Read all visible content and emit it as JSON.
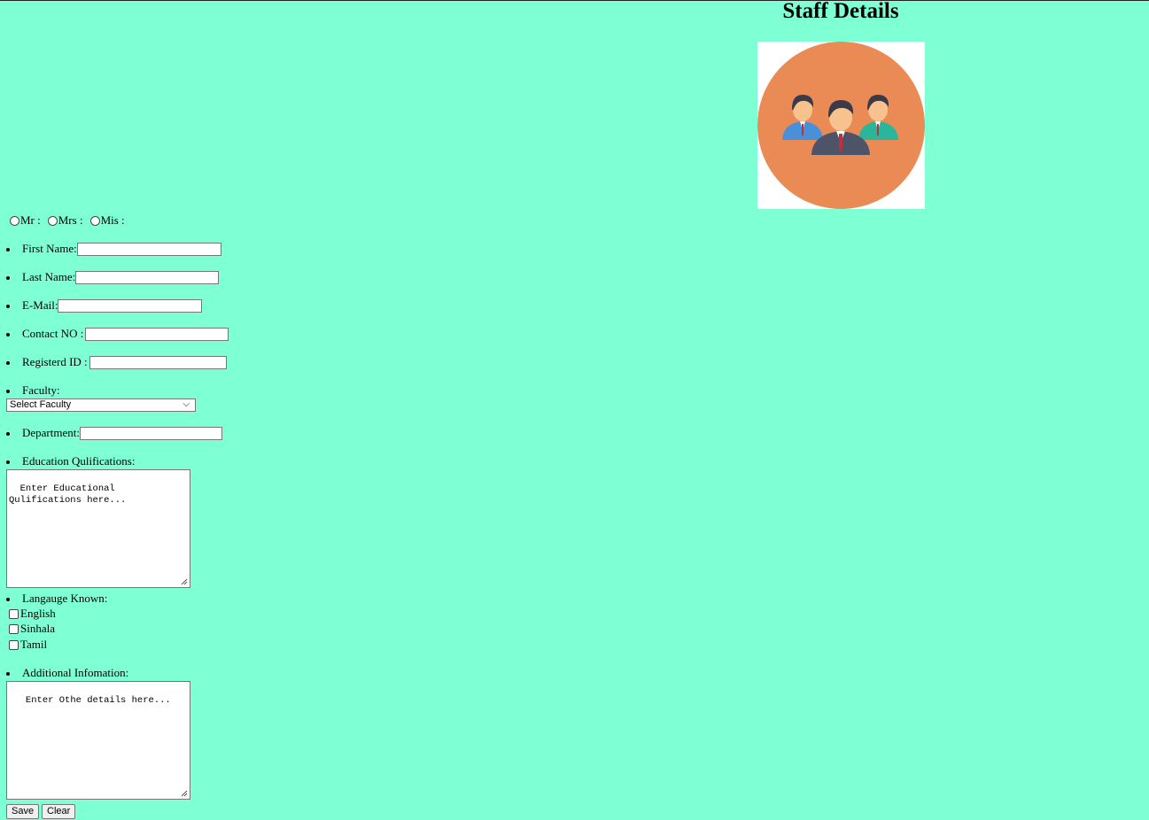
{
  "header": {
    "title": "Staff Details",
    "logo_icon": "staff-group-icon"
  },
  "colors": {
    "background": "#7fffd4",
    "logo_circle": "#ea8a55"
  },
  "salutation": {
    "options": [
      "Mr :",
      "Mrs :",
      "Mis :"
    ]
  },
  "fields": {
    "first_name": {
      "label": "First Name:",
      "value": ""
    },
    "last_name": {
      "label": "Last Name:",
      "value": ""
    },
    "email": {
      "label": "E-Mail:",
      "value": ""
    },
    "contact": {
      "label": "Contact NO :",
      "value": ""
    },
    "reg_id": {
      "label": "Registerd ID :",
      "value": ""
    },
    "faculty": {
      "label": "Faculty:",
      "selected": "Select Faculty"
    },
    "department": {
      "label": "Department:",
      "value": ""
    },
    "education": {
      "label": "Education Qulifications:",
      "placeholder": "Enter Educational Qulifications here..."
    },
    "languages": {
      "label": "Langauge Known:",
      "options": [
        "English",
        "Sinhala",
        "Tamil"
      ]
    },
    "additional": {
      "label": "Additional Infomation:",
      "placeholder": " Enter Othe details here..."
    }
  },
  "buttons": {
    "save": "Save",
    "clear": "Clear"
  }
}
